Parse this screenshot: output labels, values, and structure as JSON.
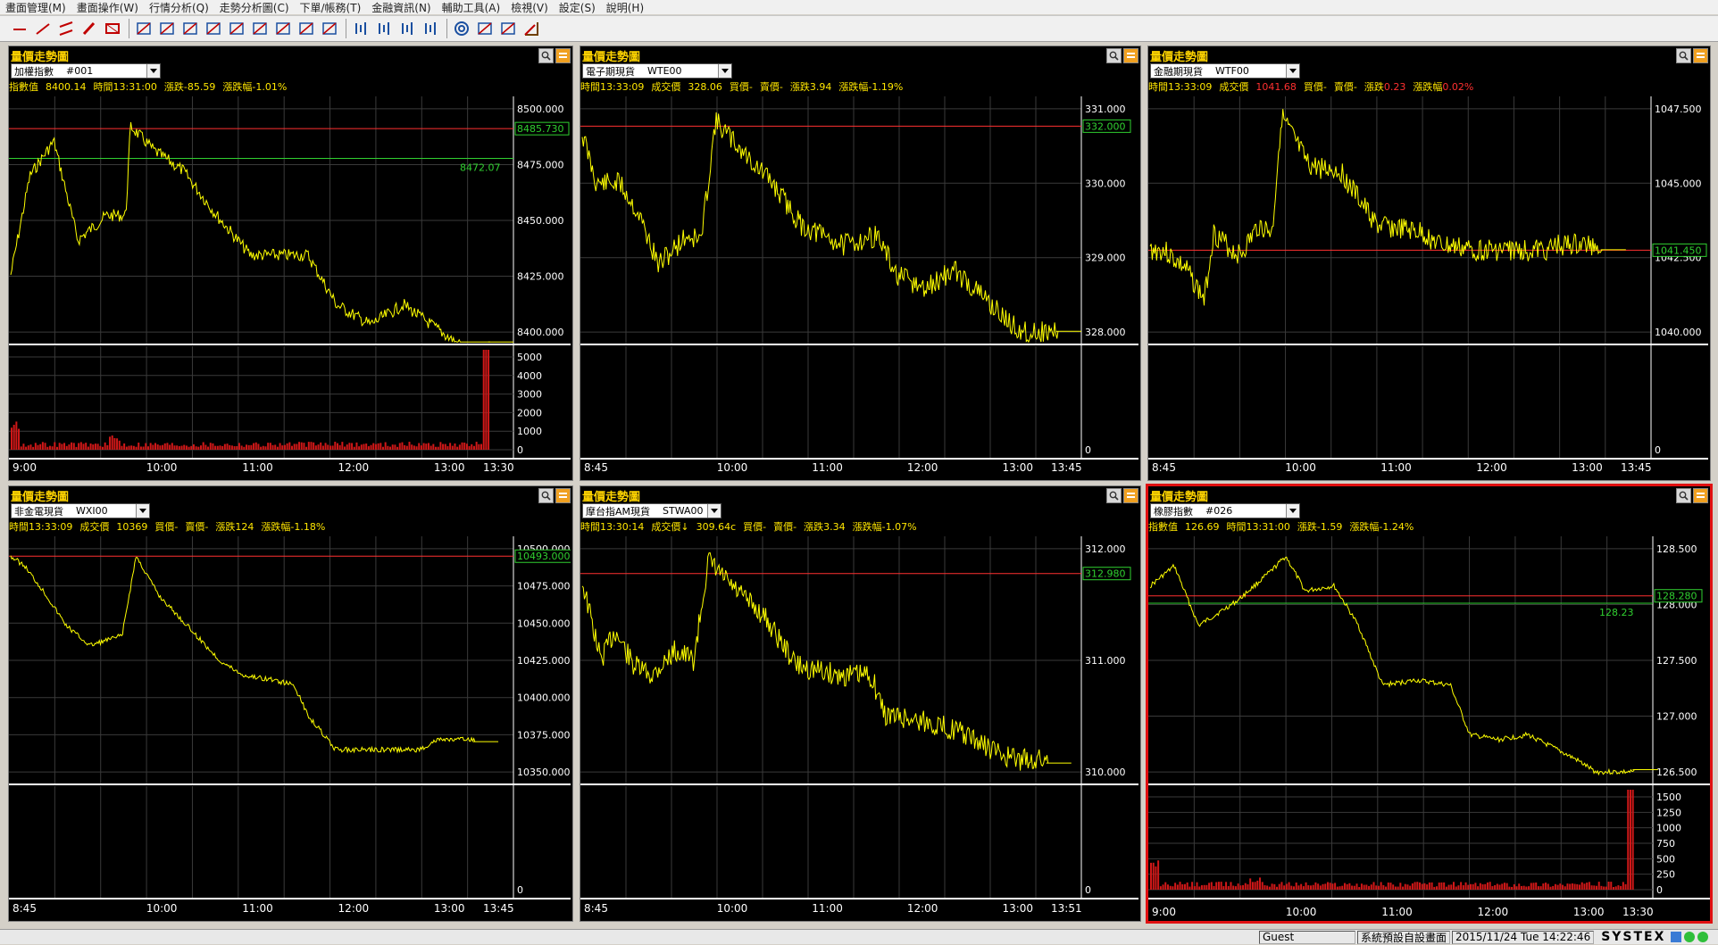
{
  "menu": [
    "畫面管理(M)",
    "畫面操作(W)",
    "行情分析(Q)",
    "走勢分析圖(C)",
    "下單/帳務(T)",
    "金融資訊(N)",
    "輔助工具(A)",
    "檢視(V)",
    "設定(S)",
    "說明(H)"
  ],
  "toolbar_icons": [
    "trend-line-icon",
    "segment-line-icon",
    "parallel-line-icon",
    "pen-icon",
    "rectangle-icon",
    "cross-rect-icon",
    "horizontal-lines-icon",
    "fib-icon",
    "grid-icon",
    "wave-icon",
    "arrow-icon",
    "diagonal-icon",
    "diagonal-icon",
    "diagonal-icon",
    "bar-icon",
    "bar-icon",
    "bar-icon",
    "bar-icon",
    "circle-target-icon",
    "pencil-icon",
    "eraser-icon",
    "angle-icon"
  ],
  "panels": [
    {
      "id": "p1",
      "title": "量價走勢圖",
      "name": "加權指數",
      "code": "#001",
      "info": [
        {
          "t": "指數值"
        },
        {
          "t": "8400.14"
        },
        {
          "t": "時間13:31:00"
        },
        {
          "t": "漲跌-85.59"
        },
        {
          "t": "漲跌幅-1.01%"
        }
      ],
      "y_ticks": [
        "8500.000",
        "8475.000",
        "8450.000",
        "8425.000",
        "8400.000"
      ],
      "ref_label": "8485.730",
      "line_label": "8472.07",
      "vol_ticks": [
        "5000",
        "4000",
        "3000",
        "2000",
        "1000",
        "0"
      ],
      "x_ticks": [
        "9:00",
        "10:00",
        "11:00",
        "12:00",
        "13:00",
        "13:30"
      ]
    },
    {
      "id": "p2",
      "title": "量價走勢圖",
      "name": "電子期現貨",
      "code": "WTE00",
      "info": [
        {
          "t": "時間13:33:09"
        },
        {
          "t": "成交價"
        },
        {
          "t": "328.06"
        },
        {
          "t": "買價-"
        },
        {
          "t": "賣價-"
        },
        {
          "t": "漲跌3.94"
        },
        {
          "t": "漲跌幅-1.19%"
        }
      ],
      "y_ticks": [
        "331.000",
        "330.000",
        "329.000",
        "328.000"
      ],
      "ref_label": "332.000",
      "line_label": "",
      "vol_ticks": [
        "0"
      ],
      "x_ticks": [
        "8:45",
        "10:00",
        "11:00",
        "12:00",
        "13:00",
        "13:45"
      ]
    },
    {
      "id": "p3",
      "title": "量價走勢圖",
      "name": "金融期現貨",
      "code": "WTF00",
      "info": [
        {
          "t": "時間13:33:09"
        },
        {
          "t": "成交價"
        },
        {
          "t": "1041.68",
          "c": "red"
        },
        {
          "t": "買價-"
        },
        {
          "t": "賣價-"
        },
        {
          "t": "漲跌",
          "tail": "0.23"
        },
        {
          "t": "漲跌幅",
          "tail": "0.02%"
        }
      ],
      "y_ticks": [
        "1047.500",
        "1045.000",
        "1042.500",
        "1040.000"
      ],
      "ref_label": "1041.450",
      "line_label": "",
      "vol_ticks": [
        "0"
      ],
      "x_ticks": [
        "8:45",
        "10:00",
        "11:00",
        "12:00",
        "13:00",
        "13:45"
      ]
    },
    {
      "id": "p4",
      "title": "量價走勢圖",
      "name": "非金電現貨",
      "code": "WXI00",
      "info": [
        {
          "t": "時間13:33:09"
        },
        {
          "t": "成交價"
        },
        {
          "t": "10369"
        },
        {
          "t": "買價-"
        },
        {
          "t": "賣價-"
        },
        {
          "t": "漲跌124"
        },
        {
          "t": "漲跌幅-1.18%"
        }
      ],
      "y_ticks": [
        "10500.000",
        "10475.000",
        "10450.000",
        "10425.000",
        "10400.000",
        "10375.000",
        "10350.000"
      ],
      "ref_label": "10493.000",
      "line_label": "",
      "vol_ticks": [
        "0"
      ],
      "x_ticks": [
        "8:45",
        "10:00",
        "11:00",
        "12:00",
        "13:00",
        "13:45"
      ]
    },
    {
      "id": "p5",
      "title": "量價走勢圖",
      "name": "摩台指AM現貨",
      "code": "STWA00",
      "info": [
        {
          "t": "時間13:30:14"
        },
        {
          "t": "成交價↓"
        },
        {
          "t": "309.64c"
        },
        {
          "t": "買價-"
        },
        {
          "t": "賣價-"
        },
        {
          "t": "漲跌3.34"
        },
        {
          "t": "漲跌幅-1.07%"
        }
      ],
      "y_ticks": [
        "312.000",
        "311.000",
        "310.000"
      ],
      "ref_label": "312.980",
      "line_label": "",
      "vol_ticks": [
        "0"
      ],
      "x_ticks": [
        "8:45",
        "10:00",
        "11:00",
        "12:00",
        "13:00",
        "13:51"
      ]
    },
    {
      "id": "p6",
      "title": "量價走勢圖",
      "name": "橡膠指數",
      "code": "#026",
      "info": [
        {
          "t": "指數值"
        },
        {
          "t": "126.69"
        },
        {
          "t": "時間13:31:00"
        },
        {
          "t": "漲跌-1.59"
        },
        {
          "t": "漲跌幅-1.24%"
        }
      ],
      "y_ticks": [
        "128.500",
        "128.000",
        "127.500",
        "127.000",
        "126.500"
      ],
      "ref_label": "128.280",
      "line_label": "128.23",
      "vol_ticks": [
        "1500",
        "1250",
        "1000",
        "750",
        "500",
        "250",
        "0"
      ],
      "x_ticks": [
        "9:00",
        "10:00",
        "11:00",
        "12:00",
        "13:00",
        "13:30"
      ]
    }
  ],
  "status": {
    "user": "Guest",
    "screen": "系統預設自設畫面",
    "datetime": "2015/11/24 Tue 14:22:46",
    "brand": "SYSTEX"
  },
  "colors": {
    "price": "#ffff00",
    "ref": "#ff3030",
    "green": "#30d030",
    "volume": "#d01818",
    "grid": "#3a3a3a",
    "tick": "#ffffff"
  }
}
